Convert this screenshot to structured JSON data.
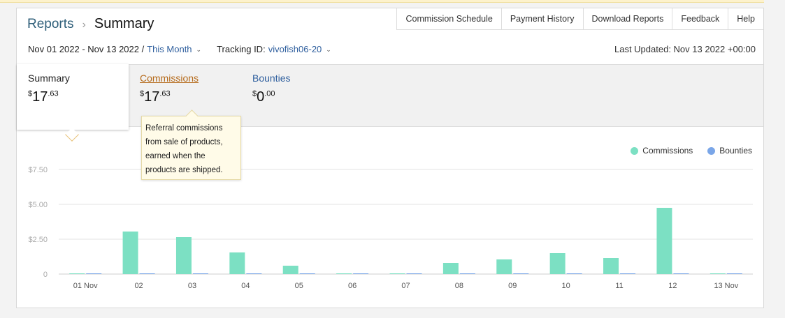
{
  "breadcrumb": {
    "root": "Reports",
    "separator": "›",
    "current": "Summary"
  },
  "top_tabs": [
    "Commission Schedule",
    "Payment History",
    "Download Reports",
    "Feedback",
    "Help"
  ],
  "filters": {
    "date_range": "Nov 01 2022 - Nov 13 2022 /",
    "period": "This Month",
    "tracking_label": "Tracking ID:",
    "tracking_id": "vivofish06-20"
  },
  "last_updated": "Last Updated: Nov 13 2022 +00:00",
  "stats": [
    {
      "label": "Summary",
      "currency": "$",
      "whole": "17",
      "fraction": ".63"
    },
    {
      "label": "Commissions",
      "currency": "$",
      "whole": "17",
      "fraction": ".63"
    },
    {
      "label": "Bounties",
      "currency": "$",
      "whole": "0",
      "fraction": ".00"
    }
  ],
  "tooltip": {
    "lines": [
      "Referral commissions",
      "from sale of products,",
      "earned when the",
      "products are shipped."
    ]
  },
  "colors": {
    "commissions": "#7ce0c3",
    "bounties": "#7aa6e8"
  },
  "chart_data": {
    "type": "bar",
    "categories": [
      "01 Nov",
      "02",
      "03",
      "04",
      "05",
      "06",
      "07",
      "08",
      "09",
      "10",
      "11",
      "12",
      "13 Nov"
    ],
    "series": [
      {
        "name": "Commissions",
        "values": [
          0.05,
          3.05,
          2.65,
          1.55,
          0.6,
          0.05,
          0.05,
          0.8,
          1.05,
          1.5,
          1.15,
          4.75,
          0.05
        ]
      },
      {
        "name": "Bounties",
        "values": [
          0.05,
          0.05,
          0.05,
          0.05,
          0.05,
          0.05,
          0.05,
          0.05,
          0.05,
          0.05,
          0.05,
          0.05,
          0.05
        ]
      }
    ],
    "yticks": [
      "0",
      "$2.50",
      "$5.00",
      "$7.50"
    ],
    "ylim": [
      0,
      7.5
    ],
    "grid": true,
    "legend": "top-right"
  }
}
